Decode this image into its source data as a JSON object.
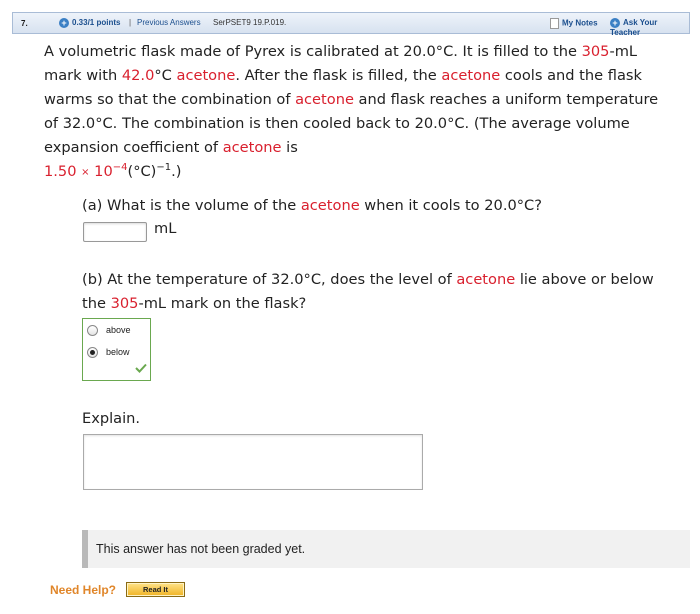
{
  "header": {
    "question_number": "7.",
    "points": "0.33/1 points",
    "separator": "|",
    "previous_answers": "Previous Answers",
    "problem_code": "SerPSET9 19.P.019.",
    "my_notes": "My Notes",
    "ask_teacher": "Ask Your Teacher"
  },
  "question": {
    "t1": "A volumetric flask made of Pyrex is calibrated at 20.0°C. It is filled to the ",
    "r1": "305",
    "t2": "-mL mark with ",
    "r2": "42.0",
    "t3": "°C ",
    "r3": "acetone",
    "t4": ". After the flask is filled, the ",
    "r4": "acetone",
    "t5": " cools and the flask warms so that the combination of ",
    "r5": "acetone",
    "t6": " and flask reaches a uniform temperature of 32.0°C. The combination is then cooled back to 20.0°C. (The average volume expansion coefficient of ",
    "r6": "acetone",
    "t7": " is ",
    "coef": "1.50",
    "times": "×",
    "pow_base": "10",
    "pow_exp": "−4",
    "unit_mid": "(°C)",
    "unit_exp": "−1",
    "t8": ".)"
  },
  "part_a": {
    "t1": "(a) What is the volume of the ",
    "r1": "acetone",
    "t2": " when it cools to 20.0°C?",
    "input_value": "",
    "unit": "mL"
  },
  "part_b": {
    "t1": "(b) At the temperature of 32.0°C, does the level of ",
    "r1": "acetone",
    "t2": " lie above or below the ",
    "r2": "305",
    "t3": "-mL mark on the flask?",
    "options": [
      "above",
      "below"
    ],
    "selected": "below"
  },
  "explain": {
    "label": "Explain.",
    "value": ""
  },
  "graded_text": "This answer has not been graded yet.",
  "help": {
    "label": "Need Help?",
    "read_button": "Read It"
  },
  "colors": {
    "highlight": "#d9202e",
    "link": "#1b4f8e",
    "correct": "#6aa84f",
    "help": "#e0862a"
  }
}
